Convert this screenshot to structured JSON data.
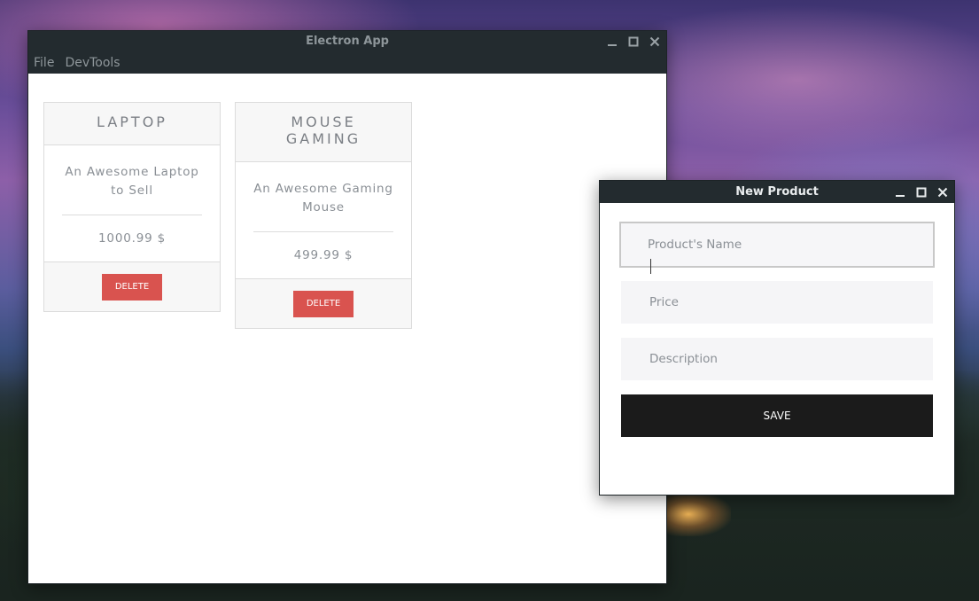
{
  "main_window": {
    "title": "Electron App",
    "menu": [
      "File",
      "DevTools"
    ]
  },
  "products": [
    {
      "name": "LAPTOP",
      "description": "An Awesome Laptop to Sell",
      "price": "1000.99 $",
      "delete_label": "DELETE"
    },
    {
      "name": "MOUSE GAMING",
      "description": "An Awesome Gaming Mouse",
      "price": "499.99 $",
      "delete_label": "DELETE"
    }
  ],
  "new_product_window": {
    "title": "New Product",
    "fields": {
      "name": {
        "placeholder": "Product's Name",
        "value": ""
      },
      "price": {
        "placeholder": "Price",
        "value": ""
      },
      "description": {
        "placeholder": "Description",
        "value": ""
      }
    },
    "save_label": "SAVE"
  },
  "icons": {
    "minimize": "minimize-icon",
    "maximize": "maximize-icon",
    "close": "close-icon"
  },
  "colors": {
    "titlebar_bg": "#232b2f",
    "delete_button": "#d9534f",
    "save_button": "#1b1b1b"
  }
}
